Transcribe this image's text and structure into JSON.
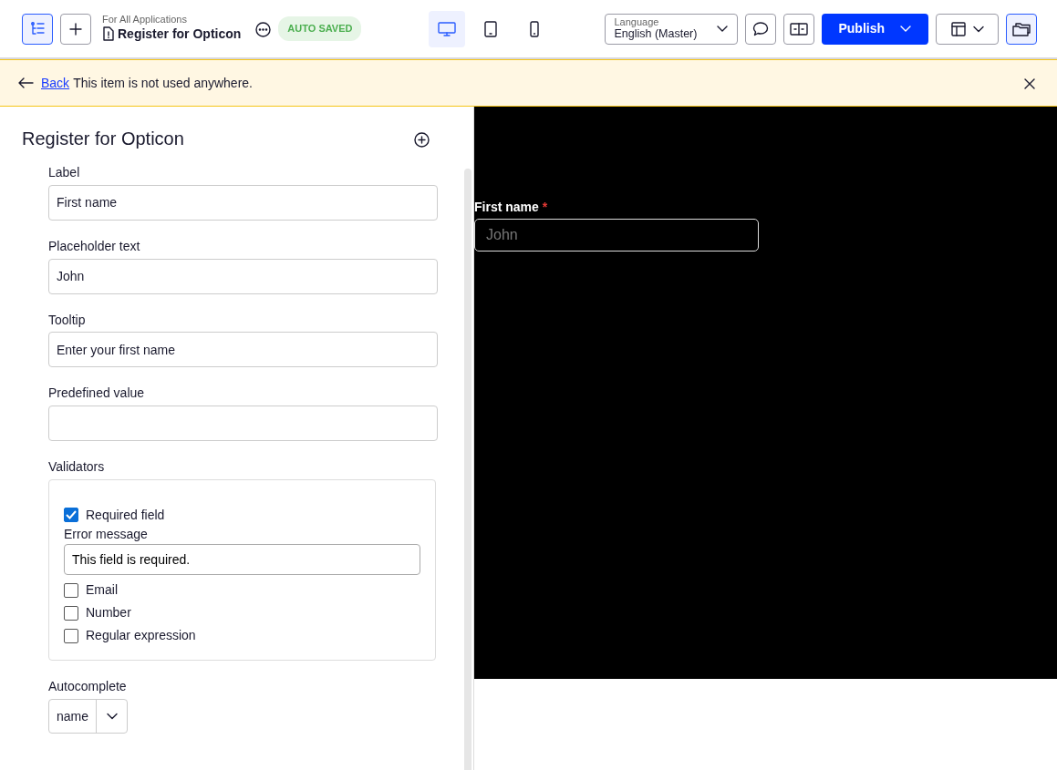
{
  "header": {
    "breadcrumb": "For All Applications",
    "title": "Register for Opticon",
    "status": "AUTO SAVED",
    "devices": [
      {
        "kind": "desktop",
        "selected": true
      },
      {
        "kind": "tablet",
        "selected": false
      },
      {
        "kind": "mobile",
        "selected": false
      }
    ],
    "language": {
      "label": "Language",
      "value": "English (Master)"
    },
    "publish": "Publish"
  },
  "notice": {
    "back": "Back",
    "text": "This item is not used anywhere."
  },
  "panel": {
    "title": "Register for Opticon",
    "fields": [
      {
        "label": "Label",
        "value": "First name"
      },
      {
        "label": "Placeholder text",
        "value": "John"
      },
      {
        "label": "Tooltip",
        "value": "Enter your first name"
      },
      {
        "label": "Predefined value"
      }
    ],
    "validators": {
      "label": "Validators",
      "items": [
        {
          "kind": "checkbox",
          "label": "Required field",
          "checked": true
        },
        {
          "kind": "message",
          "label": "Error message",
          "value": "This field is required."
        },
        {
          "kind": "checkbox",
          "label": "Email",
          "checked": false
        },
        {
          "kind": "checkbox",
          "label": "Number",
          "checked": false
        },
        {
          "kind": "checkbox",
          "label": "Regular expression",
          "checked": false
        }
      ]
    },
    "autocomplete": {
      "label": "Autocomplete",
      "value": "name"
    }
  },
  "preview": {
    "label": "First name",
    "required_mark": "*",
    "placeholder": "John"
  }
}
